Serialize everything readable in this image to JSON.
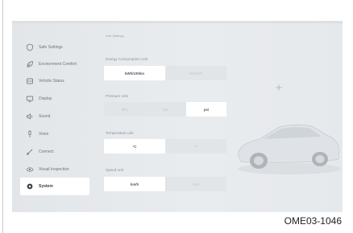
{
  "sidebar": {
    "items": [
      {
        "label": "Safe Settings",
        "icon": "shield-icon",
        "active": false
      },
      {
        "label": "Environment Comfort",
        "icon": "leaf-icon",
        "active": false
      },
      {
        "label": "Vehicle Status",
        "icon": "car-icon",
        "active": false
      },
      {
        "label": "Display",
        "icon": "monitor-icon",
        "active": false
      },
      {
        "label": "Sound",
        "icon": "speaker-icon",
        "active": false
      },
      {
        "label": "Voice",
        "icon": "microphone-icon",
        "active": false
      },
      {
        "label": "Connect",
        "icon": "link-icon",
        "active": false
      },
      {
        "label": "Visual Inspection",
        "icon": "eye-icon",
        "active": false
      },
      {
        "label": "System",
        "icon": "gear-icon",
        "active": true
      }
    ]
  },
  "main": {
    "section_title": "Unit Settings",
    "energy": {
      "label": "Energy Consumption Unit",
      "options": [
        {
          "label": "kWh/100km",
          "selected": true
        },
        {
          "label": "km/kWh",
          "selected": false
        }
      ]
    },
    "pressure": {
      "label": "Pressure Unit",
      "options": [
        {
          "label": "kPa",
          "selected": false
        },
        {
          "label": "bar",
          "selected": false
        },
        {
          "label": "psi",
          "selected": true
        }
      ]
    },
    "temperature": {
      "label": "Temperature unit",
      "options": [
        {
          "label": "°C",
          "selected": true
        },
        {
          "label": "°F",
          "selected": false
        }
      ]
    },
    "speed": {
      "label": "Speed unit",
      "options": [
        {
          "label": "km/h",
          "selected": true
        },
        {
          "label": "mph",
          "selected": false
        }
      ]
    }
  },
  "caption": "OME03-1046",
  "colors": {
    "screen_bg": "#e6e9ec",
    "selected_bg": "#ffffff",
    "unselected_bg": "#e2e5e8"
  }
}
